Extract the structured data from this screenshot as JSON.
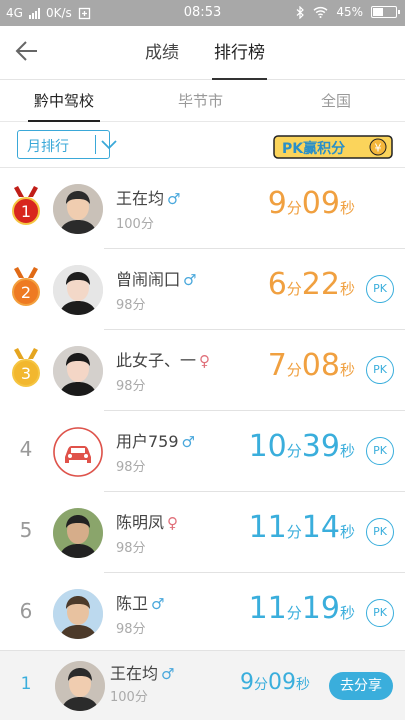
{
  "status_bar": {
    "network": "4G",
    "speed": "0K/s",
    "time": "08:53",
    "battery": "45%",
    "battery_level": 0.45
  },
  "nav": {
    "tabs": [
      "成绩",
      "排行榜"
    ],
    "active_tab": 1
  },
  "sub_tabs": {
    "items": [
      "黔中驾校",
      "毕节市",
      "全国"
    ],
    "active": 0
  },
  "filter": {
    "period_label": "月排行",
    "banner_text": "PK赢积分",
    "banner_coin": "¥"
  },
  "ranking": [
    {
      "rank": "1",
      "name": "王在均",
      "gender": "♂",
      "gender_type": "m",
      "score": "100分",
      "time_min": "9",
      "min_unit": "分",
      "time_sec": "09",
      "sec_unit": "秒",
      "color": "orange",
      "medal": "gold-red",
      "pk": false
    },
    {
      "rank": "2",
      "name": "曾闹闹囗",
      "gender": "♂",
      "gender_type": "m",
      "score": "98分",
      "time_min": "6",
      "min_unit": "分",
      "time_sec": "22",
      "sec_unit": "秒",
      "color": "orange",
      "medal": "orange",
      "pk": true
    },
    {
      "rank": "3",
      "name": "此女子、一",
      "gender": "♀",
      "gender_type": "f",
      "score": "98分",
      "time_min": "7",
      "min_unit": "分",
      "time_sec": "08",
      "sec_unit": "秒",
      "color": "orange",
      "medal": "gold",
      "pk": true
    },
    {
      "rank": "4",
      "name": "用户759",
      "gender": "♂",
      "gender_type": "m",
      "score": "98分",
      "time_min": "10",
      "min_unit": "分",
      "time_sec": "39",
      "sec_unit": "秒",
      "color": "blue",
      "medal": "",
      "pk": true
    },
    {
      "rank": "5",
      "name": "陈明凤",
      "gender": "♀",
      "gender_type": "f",
      "score": "98分",
      "time_min": "11",
      "min_unit": "分",
      "time_sec": "14",
      "sec_unit": "秒",
      "color": "blue",
      "medal": "",
      "pk": true
    },
    {
      "rank": "6",
      "name": "陈卫",
      "gender": "♂",
      "gender_type": "m",
      "score": "98分",
      "time_min": "11",
      "min_unit": "分",
      "time_sec": "19",
      "sec_unit": "秒",
      "color": "blue",
      "medal": "",
      "pk": true
    }
  ],
  "pk_label": "PK",
  "my_rank": {
    "rank": "1",
    "name": "王在均",
    "gender": "♂",
    "score": "100分",
    "time_min": "9",
    "min_unit": "分",
    "time_sec": "09",
    "sec_unit": "秒",
    "share_label": "去分享"
  },
  "colors": {
    "accent_blue": "#3aaedc",
    "orange": "#f0a040",
    "medal_red": "#d8261e",
    "status_bar": "#a8a8a8"
  }
}
